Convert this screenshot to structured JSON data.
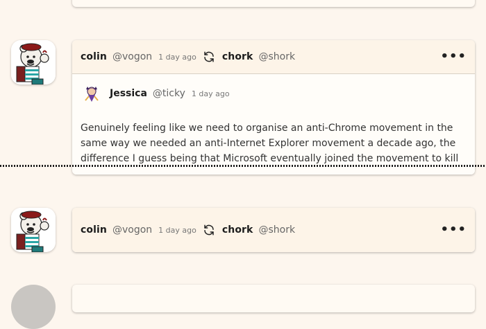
{
  "posts": [
    {
      "author": {
        "name": "colin",
        "handle": "@vogon"
      },
      "time": "1 day ago",
      "boosted_author": {
        "name": "chork",
        "handle": "@shork"
      },
      "quote": {
        "author": {
          "name": "Jessica",
          "handle": "@ticky"
        },
        "time": "1 day ago",
        "body": "Genuinely feeling like we need to organise an anti-Chrome movement in the same way we needed an anti-Internet Explorer movement a decade ago, the difference I guess being that Microsoft eventually joined the movement to kill"
      }
    },
    {
      "author": {
        "name": "colin",
        "handle": "@vogon"
      },
      "time": "1 day ago",
      "boosted_author": {
        "name": "chork",
        "handle": "@shork"
      }
    }
  ],
  "icons": {
    "boost": "repeat-icon",
    "menu": "more-horizontal-icon",
    "more_glyph": "•••"
  },
  "colors": {
    "background": "#fdf6ee",
    "card": "#fffaf3",
    "header": "#fdf4e8",
    "avatar_beret": "#8b1a1a",
    "avatar_stripes": "#2aa6a6"
  }
}
